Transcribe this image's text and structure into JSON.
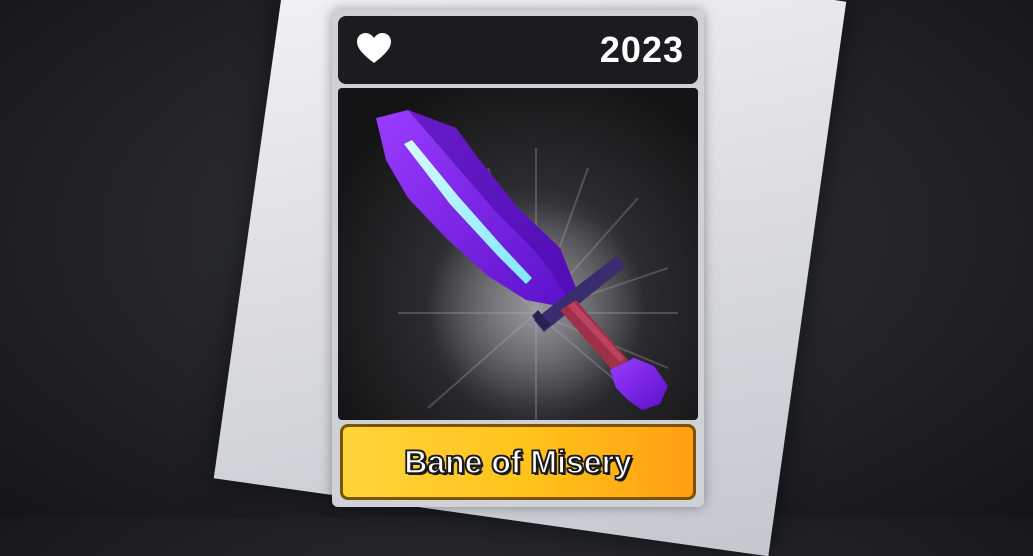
{
  "card": {
    "favorite_icon": "heart-icon",
    "year": "2023",
    "item_name": "Bane of Misery",
    "item_image": "purple-sword"
  },
  "colors": {
    "name_plate": "#ffc21a",
    "blade_glow": "#aef4ff",
    "sword_purple": "#7a20e8"
  }
}
